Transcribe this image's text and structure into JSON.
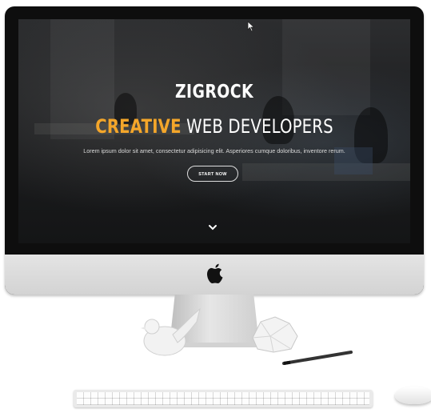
{
  "hero": {
    "title": "ZIGROCK",
    "subtitle_accent": "CREATIVE",
    "subtitle_rest": "WEB DEVELOPERS",
    "description": "Lorem ipsum dolor sit amet, consectetur adipisicing elit. Asperiores cumque doloribus, inventore rerum.",
    "cta_label": "START NOW"
  },
  "colors": {
    "accent": "#f4a62a",
    "overlay": "#1d1e20",
    "text": "#ffffff"
  },
  "icons": [
    "apple-logo",
    "chevron-down-icon",
    "mouse-cursor"
  ]
}
